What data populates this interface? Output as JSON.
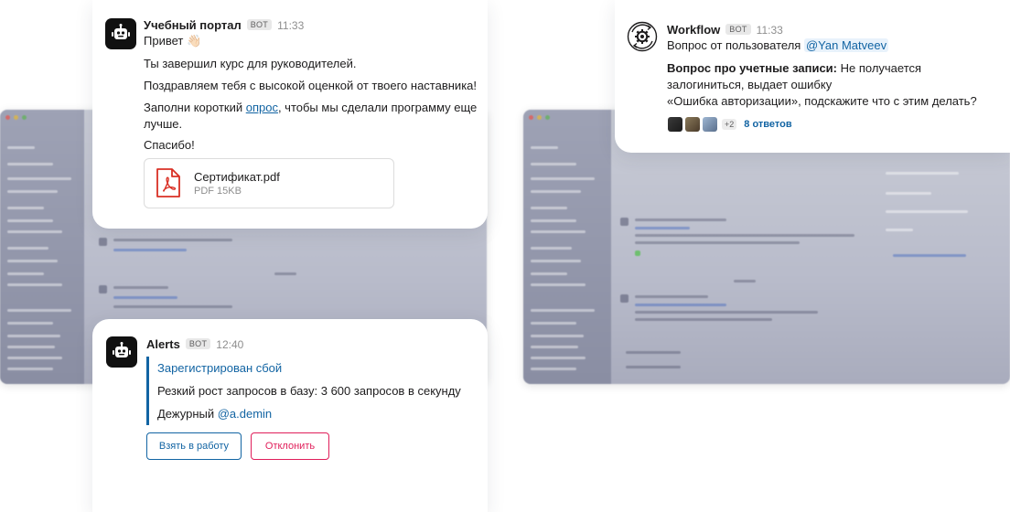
{
  "learning_message": {
    "sender": "Учебный портал",
    "bot_tag": "BOT",
    "time": "11:33",
    "greeting": "Привет 👋🏻",
    "line1": "Ты завершил курс для руководителей.",
    "line2": "Поздравляем тебя с высокой оценкой от твоего наставника!",
    "line3_before": "Заполни короткий ",
    "line3_link": "опрос",
    "line3_after": ", чтобы мы сделали программу еще лучше.",
    "line4": "Спасибо!",
    "attachment": {
      "file_name": "Сертификат.pdf",
      "file_meta": "PDF 15KB",
      "icon": "pdf-icon"
    }
  },
  "alert_message": {
    "sender": "Alerts",
    "bot_tag": "BOT",
    "time": "12:40",
    "title": "Зарегистрирован сбой",
    "detail": "Резкий рост запросов в базу: 3 600 запросов в секунду",
    "duty_label": "Дежурный ",
    "duty_mention": "@a.demin",
    "accept_button": "Взять в работу",
    "decline_button": "Отклонить"
  },
  "workflow_message": {
    "sender": "Workflow",
    "bot_tag": "BOT",
    "time": "11:33",
    "question_prefix": "Вопрос от пользователя ",
    "mention": "@Yan Matveev",
    "question_bold": "Вопрос про учетные записи:",
    "question_text_1": " Не получается залогиниться, выдает ошибку",
    "question_text_2": "«Ошибка авторизации», подскажите что с этим делать?",
    "more_count": "+2",
    "replies": "8 ответов"
  },
  "colors": {
    "link": "#1264a3",
    "danger": "#e01e5a",
    "bot_avatar": "#111111",
    "pdf_red": "#d93025"
  }
}
